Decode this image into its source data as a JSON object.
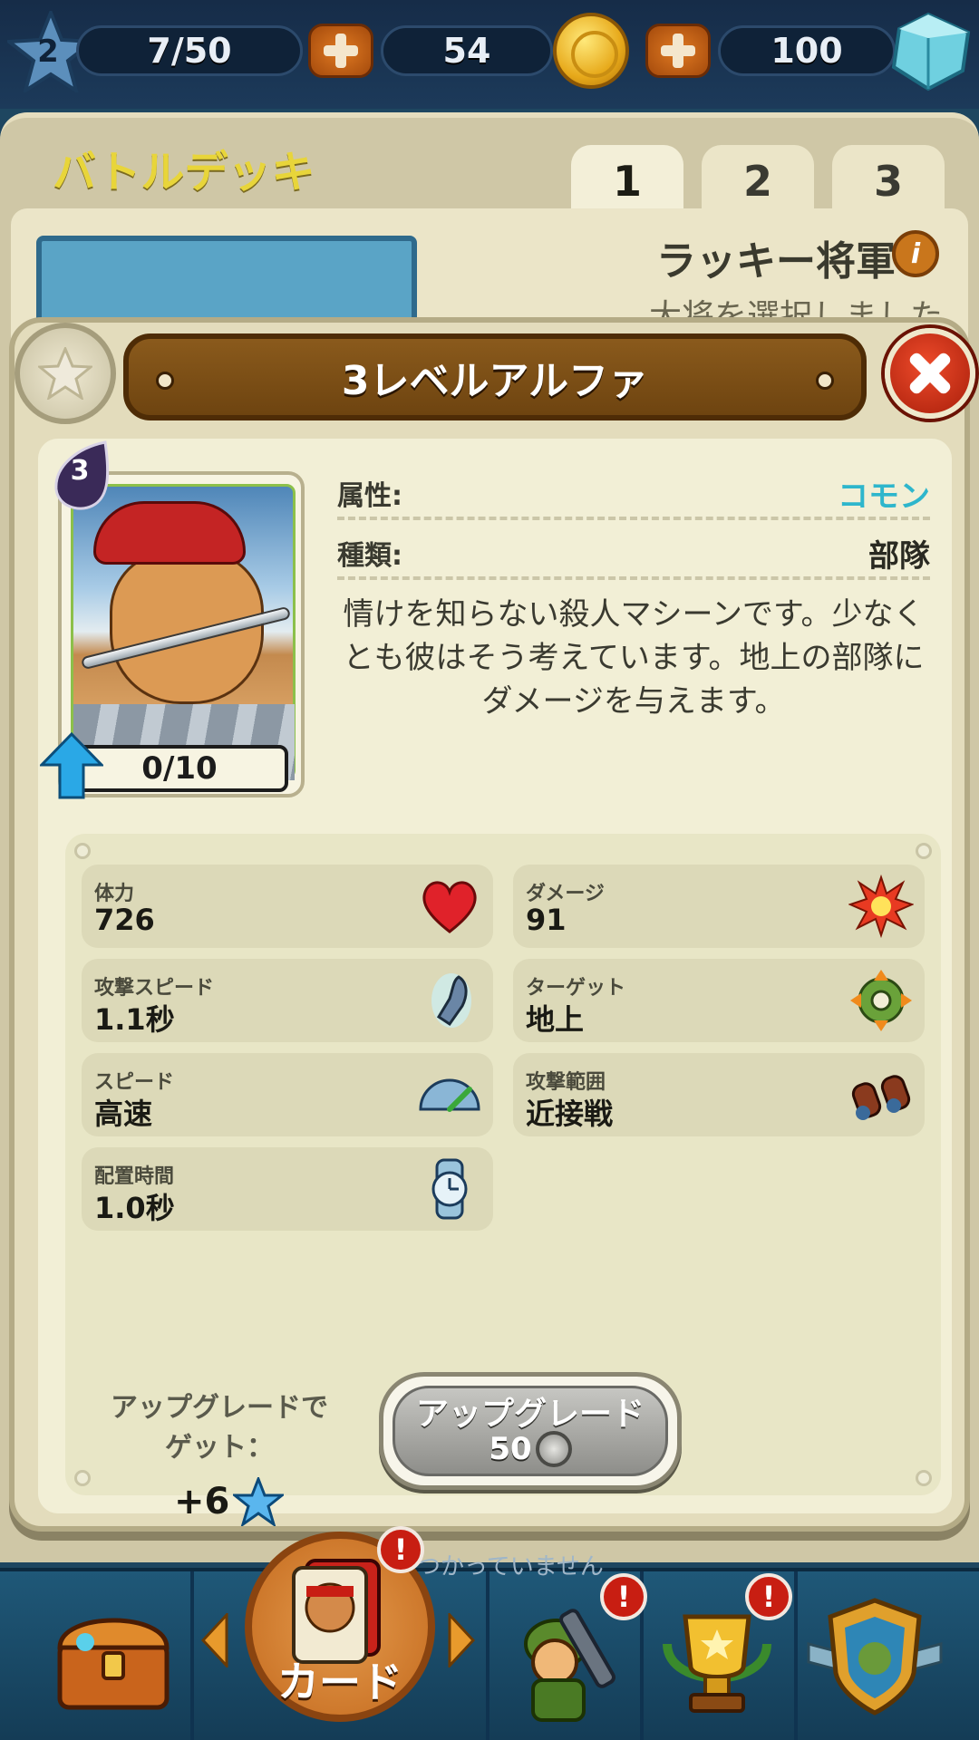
{
  "top_bar": {
    "player_level": "2",
    "energy": "7/50",
    "coins": "54",
    "gems": "100"
  },
  "deck": {
    "title": "バトルデッキ",
    "tabs": [
      "1",
      "2",
      "3"
    ],
    "general_name": "ラッキー将軍",
    "general_status": "大将を選択しました"
  },
  "modal": {
    "title": "3レベルアルファ",
    "card": {
      "level": "3",
      "progress": "0/10"
    },
    "attributes": [
      {
        "label": "属性:",
        "value": "コモン",
        "color": "#2eb6cc"
      },
      {
        "label": "種類:",
        "value": "部隊",
        "color": "#2a2a22"
      }
    ],
    "description": "情けを知らない殺人マシーンです。少なくとも彼はそう考えています。地上の部隊にダメージを与えます。",
    "stats": [
      {
        "label": "体力",
        "value": "726",
        "icon": "heart-icon"
      },
      {
        "label": "ダメージ",
        "value": "91",
        "icon": "explosion-icon"
      },
      {
        "label": "攻撃スピード",
        "value": "1.1秒",
        "icon": "bullet-icon"
      },
      {
        "label": "ターゲット",
        "value": "地上",
        "icon": "target-icon"
      },
      {
        "label": "スピード",
        "value": "高速",
        "icon": "speedometer-icon"
      },
      {
        "label": "攻撃範囲",
        "value": "近接戦",
        "icon": "binoculars-icon"
      },
      {
        "label": "配置時間",
        "value": "1.0秒",
        "icon": "stopwatch-icon"
      }
    ],
    "reward_label": "アップグレードでゲット：",
    "reward_amount": "+6",
    "upgrade_button": {
      "label": "アップグレード",
      "cost": "50"
    }
  },
  "bottom_nav": {
    "cards_label": "カード",
    "hidden_text": "つかっていません",
    "notification_symbol": "!"
  },
  "colors": {
    "accent_gold": "#e8d53a",
    "common_rarity": "#2eb6cc",
    "close_red": "#d8341c"
  }
}
